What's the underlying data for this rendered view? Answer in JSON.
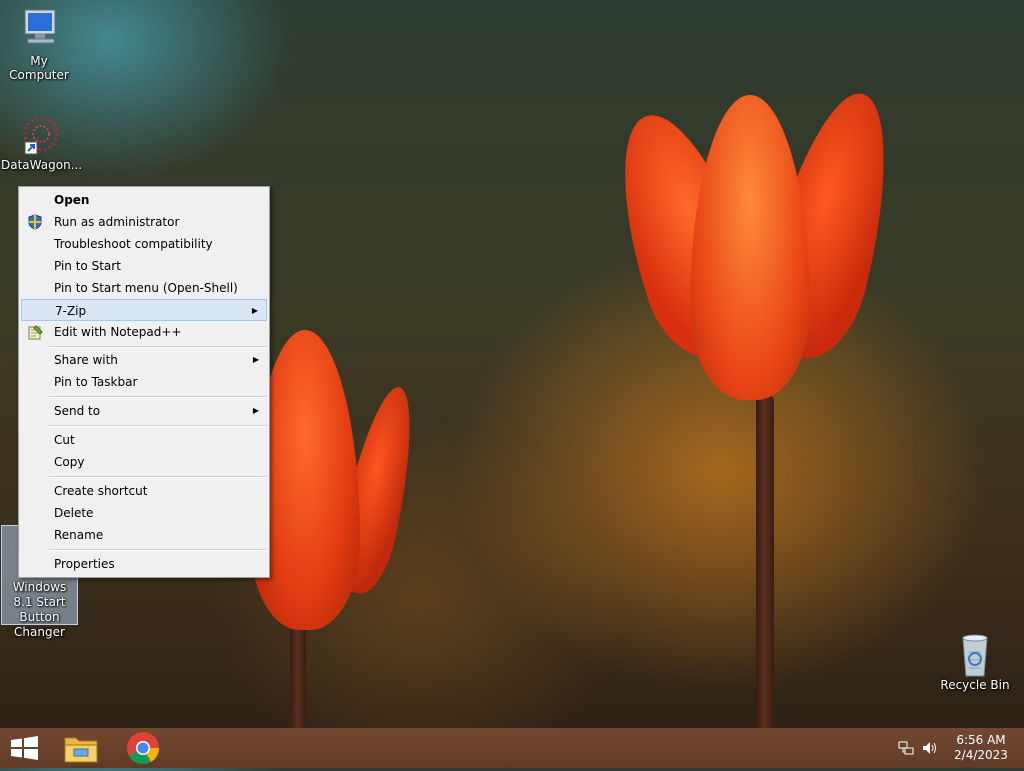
{
  "desktop": {
    "icons": [
      {
        "label": "My Computer"
      },
      {
        "label": "DataWagon..."
      },
      {
        "label": "Windows 8.1 Start Button Changer"
      },
      {
        "label": "Recycle Bin"
      }
    ]
  },
  "context_menu": {
    "items": [
      {
        "label": "Open",
        "bold": true
      },
      {
        "label": "Run as administrator",
        "icon": "uac-shield-icon"
      },
      {
        "label": "Troubleshoot compatibility"
      },
      {
        "label": "Pin to Start"
      },
      {
        "label": "Pin to Start menu (Open-Shell)"
      },
      {
        "label": "7-Zip",
        "submenu": true,
        "highlighted": true
      },
      {
        "label": "Edit with Notepad++",
        "icon": "notepad-plus-plus-icon"
      },
      {
        "label": "Share with",
        "submenu": true
      },
      {
        "label": "Pin to Taskbar"
      },
      {
        "label": "Send to",
        "submenu": true
      },
      {
        "label": "Cut"
      },
      {
        "label": "Copy"
      },
      {
        "label": "Create shortcut"
      },
      {
        "label": "Delete"
      },
      {
        "label": "Rename"
      },
      {
        "label": "Properties"
      }
    ],
    "submenu_arrow": "▶"
  },
  "taskbar": {
    "start": "windows-start-icon",
    "pinned": [
      "file-explorer-icon",
      "chrome-icon"
    ],
    "tray": {
      "time": "6:56 AM",
      "date": "2/4/2023"
    }
  }
}
